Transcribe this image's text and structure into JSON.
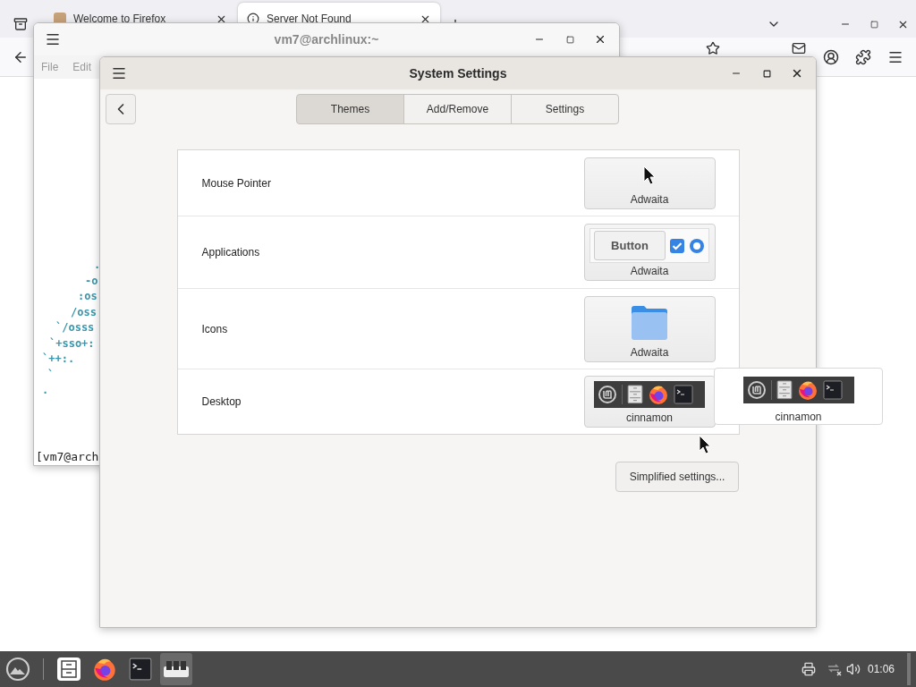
{
  "browser": {
    "tabs": [
      {
        "label": "Welcome to Firefox",
        "selected": false
      },
      {
        "label": "Server Not Found",
        "selected": true
      }
    ]
  },
  "terminal": {
    "title": "vm7@archlinux:~",
    "menu": [
      "File",
      "Edit"
    ],
    "art": [
      ".",
      "-o",
      ":os",
      "/oss",
      "`/osss",
      "`+sso+:",
      "`++:.",
      "`",
      "."
    ],
    "prompt": "[vm7@arch"
  },
  "settings": {
    "title": "System Settings",
    "tabs": [
      {
        "label": "Themes",
        "selected": true
      },
      {
        "label": "Add/Remove",
        "selected": false
      },
      {
        "label": "Settings",
        "selected": false
      }
    ],
    "rows": [
      {
        "label": "Mouse Pointer",
        "kind": "pointer",
        "value": "Adwaita"
      },
      {
        "label": "Applications",
        "kind": "applications",
        "value": "Adwaita",
        "preview_button": "Button"
      },
      {
        "label": "Icons",
        "kind": "icons",
        "value": "Adwaita"
      },
      {
        "label": "Desktop",
        "kind": "desktop",
        "value": "cinnamon"
      }
    ],
    "button": "Simplified settings..."
  },
  "popup": {
    "value": "cinnamon"
  },
  "taskbar": {
    "clock": "01:06"
  }
}
